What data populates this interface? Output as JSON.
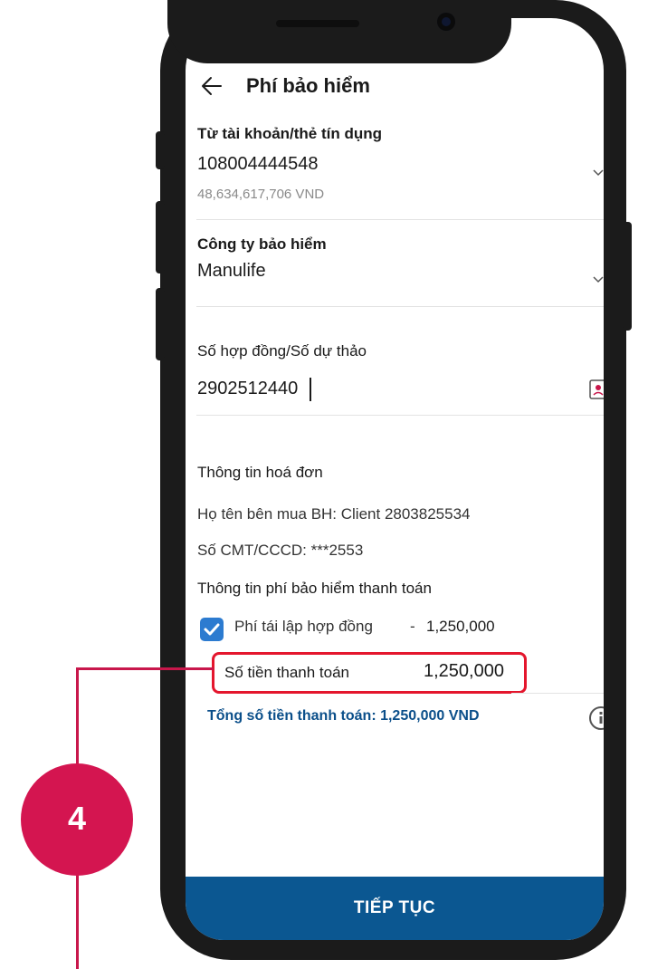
{
  "header": {
    "title": "Phí bảo hiểm"
  },
  "account": {
    "label": "Từ tài khoản/thẻ tín dụng",
    "number": "108004444548",
    "balance": "48,634,617,706 VND"
  },
  "insurer": {
    "label": "Công ty bảo hiểm",
    "value": "Manulife"
  },
  "contract": {
    "label": "Số hợp đồng/Số dự thảo",
    "value": "2902512440"
  },
  "invoice": {
    "section_title": "Thông tin hoá đơn",
    "buyer": "Họ tên bên mua BH: Client 2803825534",
    "id_number": "Số CMT/CCCD: ***2553",
    "fee_section_title": "Thông tin phí bảo hiểm thanh toán",
    "fee_item": "Phí tái lập hợp đồng",
    "fee_dash": "-",
    "fee_amount": "1,250,000",
    "fee_checked": true,
    "payment_label": "Số tiền thanh toán",
    "payment_amount": "1,250,000",
    "total": "Tổng số tiền thanh toán: 1,250,000 VND"
  },
  "cta": {
    "label": "TIẾP TỤC"
  },
  "annotation": {
    "step": "4"
  },
  "colors": {
    "primary": "#0b5791",
    "total_text": "#0b4f8a",
    "checkbox": "#2c7bd0",
    "highlight": "#e4162d",
    "annotation": "#d41550"
  },
  "icons": {
    "back": "arrow-left-icon",
    "dropdown": "chevron-down-icon",
    "contact": "contact-card-icon",
    "checkbox": "checkmark-icon",
    "info": "info-icon"
  }
}
